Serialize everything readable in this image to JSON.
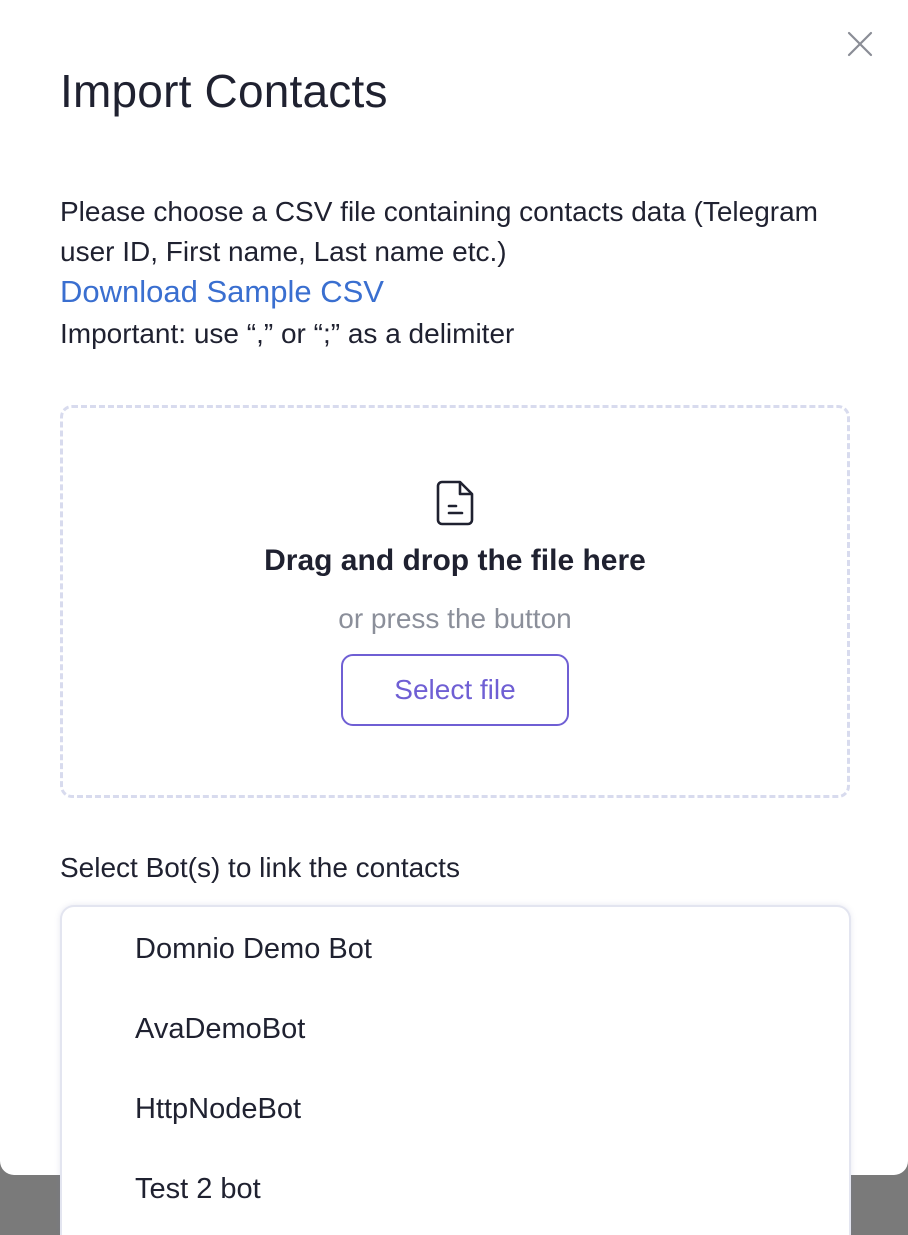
{
  "dialog": {
    "title": "Import Contacts",
    "description": "Please choose a CSV file containing contacts data (Telegram user ID, First name, Last name etc.)",
    "download_link": "Download Sample CSV",
    "important_note": "Important: use “,” or “;” as a delimiter"
  },
  "dropzone": {
    "icon": "file-icon",
    "title": "Drag and drop the file here",
    "subtitle": "or press the button",
    "button_label": "Select file"
  },
  "bots": {
    "label": "Select Bot(s) to link the contacts",
    "items": [
      "Domnio Demo Bot",
      "AvaDemoBot",
      "HttpNodeBot",
      "Test 2 bot"
    ]
  },
  "colors": {
    "accent": "#6f5fd4",
    "link": "#3a6fd0",
    "backdrop": "#7a7a7a"
  }
}
